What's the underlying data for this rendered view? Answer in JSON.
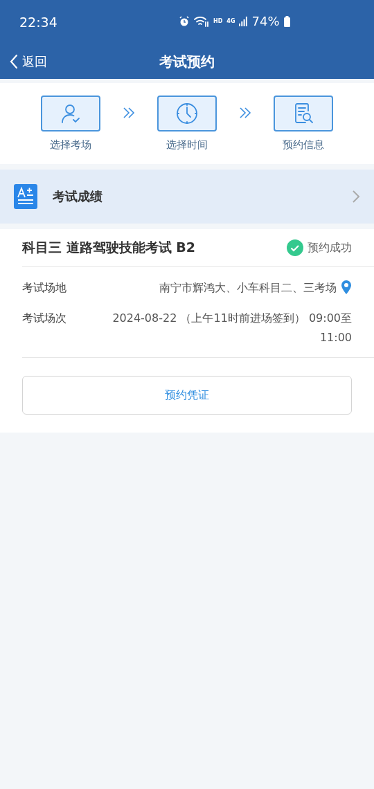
{
  "status_bar": {
    "time": "22:34",
    "hd": "HD",
    "network": "4G",
    "battery": "74%"
  },
  "nav": {
    "back": "返回",
    "title": "考试预约"
  },
  "steps": [
    {
      "kind": "person",
      "label": "选择考场"
    },
    {
      "kind": "clock",
      "label": "选择时间"
    },
    {
      "kind": "document",
      "label": "预约信息"
    }
  ],
  "score_row": {
    "label": "考试成绩"
  },
  "exam": {
    "title": "科目三 道路驾驶技能考试 B2",
    "status": "预约成功",
    "rows": [
      {
        "kind": "location",
        "label": "考试场地",
        "value": "南宁市辉鸿大、小车科目二、三考场"
      },
      {
        "kind": "plain",
        "label": "考试场次",
        "value": "2024-08-22 （上午11时前进场签到） 09:00至 11:00"
      }
    ],
    "button": "预约凭证"
  }
}
